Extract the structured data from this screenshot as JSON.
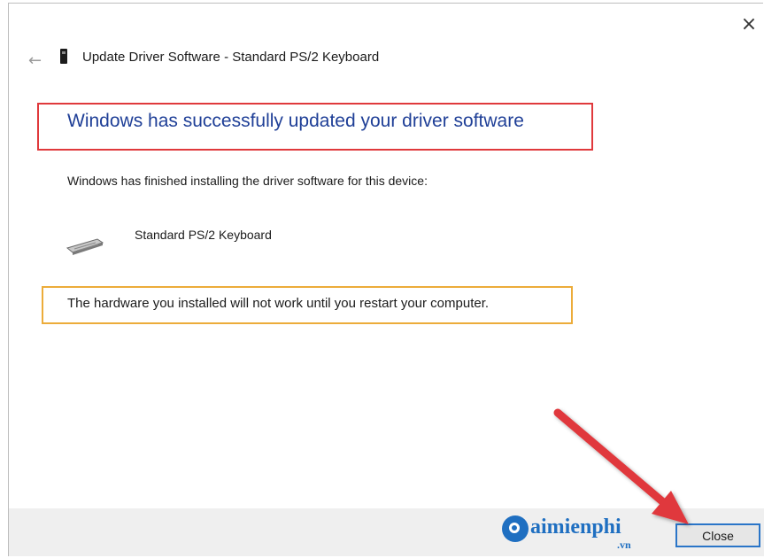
{
  "window": {
    "title": "Update Driver Software - Standard PS/2 Keyboard",
    "close_glyph": "×",
    "back_glyph": "←"
  },
  "content": {
    "headline": "Windows has successfully updated your driver software",
    "finished_text": "Windows has finished installing the driver software for this device:",
    "device_name": "Standard PS/2 Keyboard",
    "warning_text": "The hardware you installed will not work until you restart your computer."
  },
  "footer": {
    "close_label": "Close"
  },
  "watermark": {
    "logo_text": "aimienphi",
    "logo_sub": ".vn"
  },
  "colors": {
    "headline_text": "#1f3f97",
    "headline_box": "#e0393c",
    "warning_box": "#ecac3a",
    "arrow": "#e0393c",
    "button_focus": "#2a75c8",
    "logo": "#1f6fc1"
  },
  "icons": {
    "back": "back-arrow-icon",
    "title_device": "device-icon",
    "device": "keyboard-icon",
    "close": "close-icon",
    "annotation": "red-arrow-icon",
    "logo": "taimienphi-logo"
  }
}
